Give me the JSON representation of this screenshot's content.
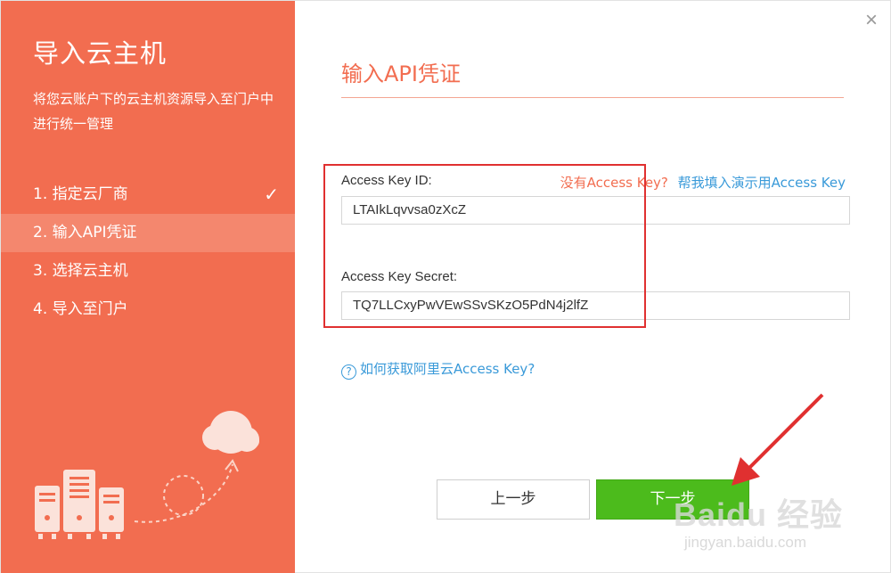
{
  "sidebar": {
    "title": "导入云主机",
    "description": "将您云账户下的云主机资源导入至门户中进行统一管理",
    "steps": [
      {
        "label": "1. 指定云厂商",
        "done": true
      },
      {
        "label": "2. 输入API凭证",
        "active": true
      },
      {
        "label": "3. 选择云主机"
      },
      {
        "label": "4. 导入至门户"
      }
    ],
    "check_icon": "✓"
  },
  "window": {
    "close_icon": "×"
  },
  "main": {
    "title": "输入API凭证",
    "access_key_id": {
      "label": "Access Key ID:",
      "value": "LTAIkLqvvsa0zXcZ"
    },
    "access_key_secret": {
      "label": "Access Key Secret:",
      "value": "TQ7LLCxyPwVEwSSvSKzO5PdN4j2lfZ"
    },
    "no_key_link": "没有Access Key?",
    "demo_key_link": "帮我填入演示用Access Key",
    "help_icon": "?",
    "help_link": "如何获取阿里云Access Key?",
    "prev_button": "上一步",
    "next_button": "下一步"
  },
  "watermark": {
    "brand": "Baidu 经验",
    "url": "jingyan.baidu.com"
  },
  "colors": {
    "accent": "#f26d50",
    "accent_light": "#f4876e",
    "link": "#3a9ad9",
    "primary_button": "#4cbb1c",
    "annotation_red": "#e03030"
  }
}
